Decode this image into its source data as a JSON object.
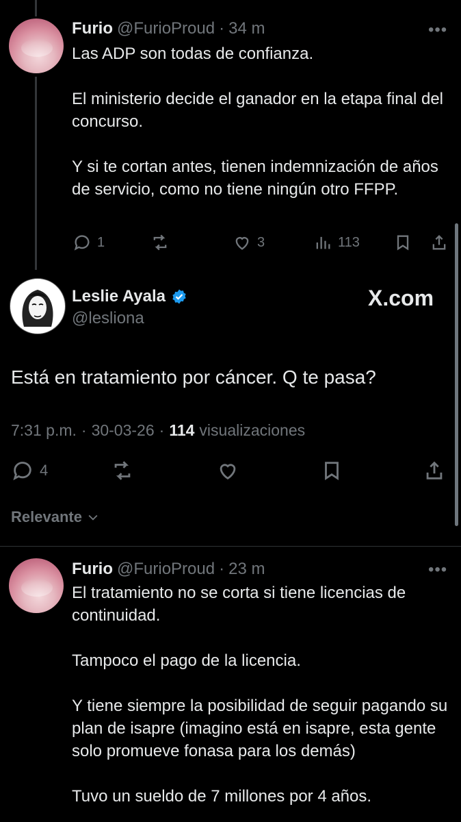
{
  "tweet1": {
    "name": "Furio",
    "handle": "@FurioProud",
    "separator": "·",
    "time": "34 m",
    "more": "•••",
    "body": "Las ADP son todas de confianza.\n\nEl ministerio decide el ganador en la etapa final del concurso.\n\nY si te cortan antes, tienen indemnización de años de servicio, como no tiene ningún otro FFPP.",
    "replies": "1",
    "likes": "3",
    "views": "113"
  },
  "main": {
    "name": "Leslie Ayala",
    "handle": "@lesliona",
    "brand": "X.com",
    "body": "Está en tratamiento por cáncer. Q te pasa?",
    "time": "7:31 p.m.",
    "date": "30-03-26",
    "sep": "·",
    "views_count": "114",
    "views_label": "visualizaciones",
    "replies": "4"
  },
  "sort": {
    "label": "Relevante"
  },
  "tweet2": {
    "name": "Furio",
    "handle": "@FurioProud",
    "separator": "·",
    "time": "23 m",
    "more": "•••",
    "body": "El tratamiento no se corta si tiene licencias de continuidad.\n\nTampoco el pago de la licencia.\n\nY tiene siempre la posibilidad de seguir pagando su plan de isapre (imagino está en isapre, esta gente solo promueve fonasa para los demás)\n\nTuvo un sueldo de 7 millones por 4 años."
  },
  "colors": {
    "background": "#000000",
    "text": "#e7e9ea",
    "secondary": "#71767b",
    "verified": "#1d9bf0",
    "divider": "#2f3336"
  }
}
